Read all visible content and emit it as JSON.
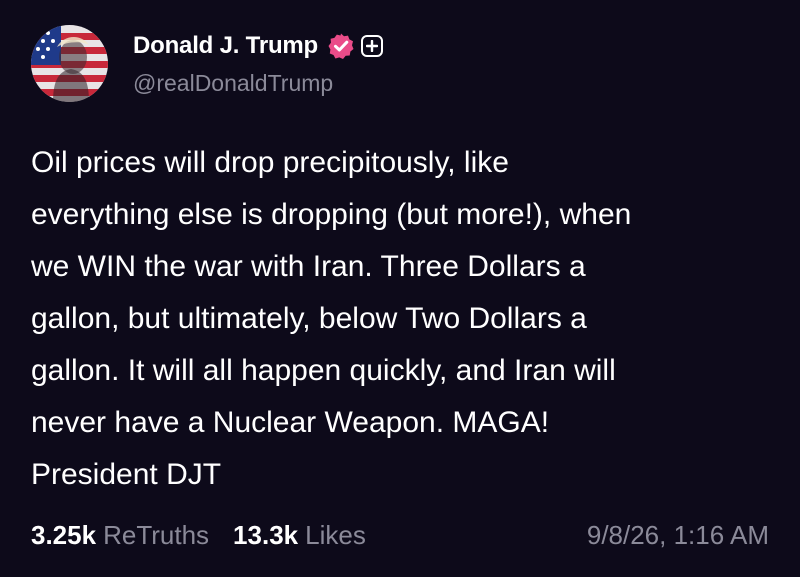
{
  "author": {
    "display_name": "Donald J. Trump",
    "handle": "@realDonaldTrump",
    "avatar_icon": "flag-portrait-avatar",
    "verified_icon": "verified-badge-icon",
    "verified_color": "#ea4c89",
    "follow_icon": "plus-icon"
  },
  "post": {
    "lines": [
      "Oil prices will drop precipitously, like",
      "everything else is dropping (but more!), when",
      "we WIN the war with Iran. Three Dollars a",
      "gallon, but ultimately, below Two Dollars a",
      "gallon. It will all happen quickly, and Iran will",
      "never have a Nuclear Weapon. MAGA!",
      "President DJT"
    ]
  },
  "stats": {
    "retruths_count": "3.25k",
    "retruths_label": "ReTruths",
    "likes_count": "13.3k",
    "likes_label": "Likes",
    "timestamp": "9/8/26, 1:16 AM"
  },
  "colors": {
    "background": "#0d0a1a",
    "text": "#ffffff",
    "muted": "#8b8a99"
  }
}
